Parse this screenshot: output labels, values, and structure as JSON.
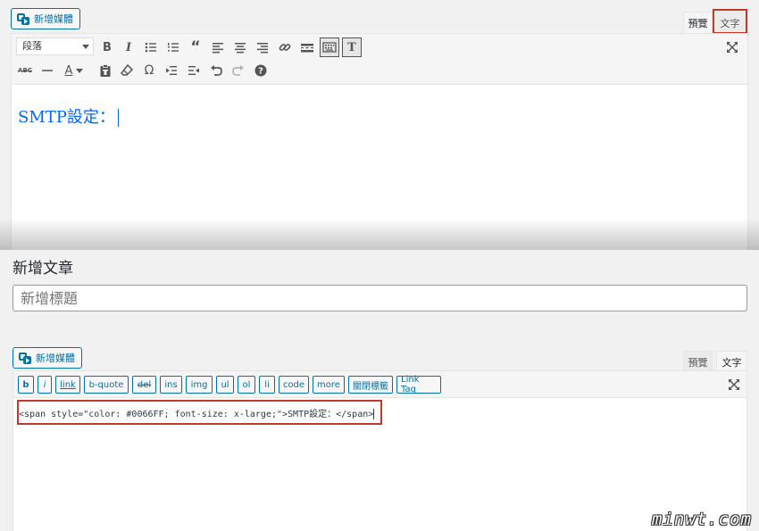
{
  "top_editor": {
    "media_button": "新增媒體",
    "tab_visual": "預覽",
    "tab_text": "文字",
    "format_select": "段落",
    "toolbar_row1": [
      "bold-icon",
      "italic-icon",
      "bullet-list-icon",
      "numbered-list-icon",
      "blockquote-icon",
      "align-left-icon",
      "align-center-icon",
      "align-right-icon",
      "link-icon",
      "read-more-icon",
      "toolbar-toggle-icon",
      "text-tab-icon"
    ],
    "toolbar_row2": [
      "strikethrough-icon",
      "horizontal-line-icon",
      "text-color-icon",
      "paste-text-icon",
      "clear-formatting-icon",
      "special-character-icon",
      "outdent-icon",
      "indent-icon",
      "undo-icon",
      "redo-icon",
      "help-icon"
    ],
    "text_color_letter": "A",
    "strike_label": "ABC",
    "content": "SMTP設定：",
    "content_color": "#0066FF"
  },
  "bottom_editor": {
    "page_title": "新增文章",
    "title_placeholder": "新增標題",
    "media_button": "新增媒體",
    "tab_visual": "預覽",
    "tab_text": "文字",
    "quicktags": [
      "b",
      "i",
      "link",
      "b-quote",
      "del",
      "ins",
      "img",
      "ul",
      "ol",
      "li",
      "code",
      "more",
      "關閉標籤",
      "Link Tag"
    ],
    "code": "<span style=\"color: #0066FF; font-size: x-large;\">SMTP設定：</span>"
  },
  "watermark": "minwt.com",
  "colors": {
    "accent": "#0073aa",
    "highlight_border": "#c0392b"
  }
}
